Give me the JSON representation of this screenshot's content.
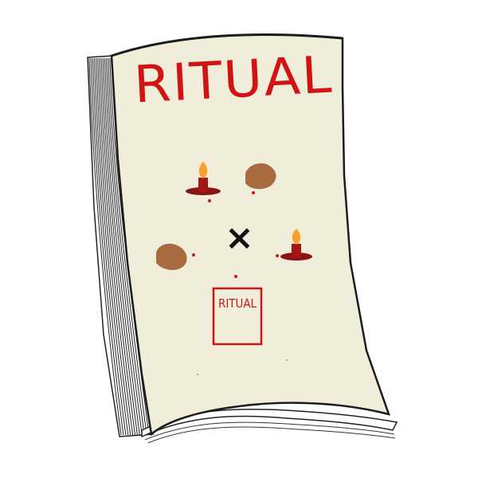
{
  "book": {
    "cover_title": "RITUAL",
    "inner_page_label": "RITUAL",
    "center_mark": "×"
  },
  "colors": {
    "page": "#f1eddb",
    "ink_red": "#d11313",
    "candle_base": "#8a1414",
    "flame": "#f7a22f",
    "rock": "#a86a3f",
    "outline": "#222222"
  },
  "icons": [
    "candle-icon",
    "candle-icon",
    "rock-icon",
    "rock-icon",
    "x-mark-icon",
    "mini-page-icon"
  ]
}
